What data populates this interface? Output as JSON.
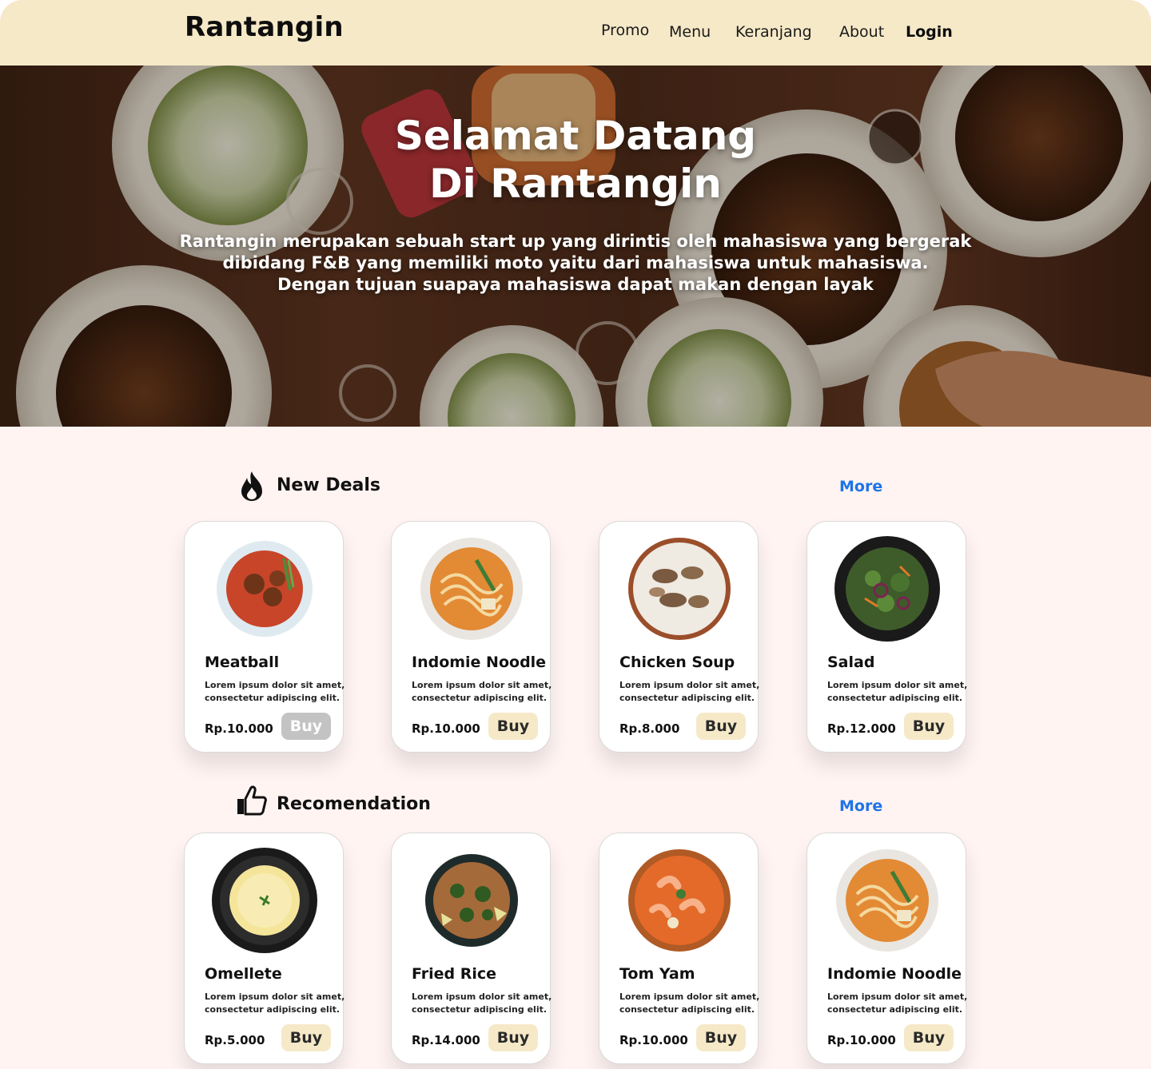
{
  "navbar": {
    "brand": "Rantangin",
    "links": {
      "promo": "Promo",
      "menu": "Menu",
      "keranjang": "Keranjang",
      "about": "About",
      "login": "Login"
    }
  },
  "hero": {
    "title_line1": "Selamat Datang",
    "title_line2": "Di Rantangin",
    "desc_line1": "Rantangin merupakan sebuah start up yang dirintis oleh mahasiswa yang bergerak",
    "desc_line2": "dibidang F&B yang memiliki moto yaitu dari mahasiswa untuk mahasiswa.",
    "desc_line3": "Dengan tujuan suapaya mahasiswa dapat makan dengan layak"
  },
  "new_deals": {
    "title": "New Deals",
    "more": "More",
    "icon": "flame-icon",
    "items": [
      {
        "name": "Meatball",
        "desc_line1": "Lorem ipsum dolor sit amet,",
        "desc_line2": "consectetur adipiscing elit.",
        "price": "Rp.10.000",
        "buy": "Buy",
        "buy_state": "disabled",
        "dish": "meatball-dish-image"
      },
      {
        "name": "Indomie Noodle",
        "desc_line1": "Lorem ipsum dolor sit amet,",
        "desc_line2": "consectetur adipiscing elit.",
        "price": "Rp.10.000",
        "buy": "Buy",
        "buy_state": "active",
        "dish": "noodle-dish-image"
      },
      {
        "name": "Chicken Soup",
        "desc_line1": "Lorem ipsum dolor sit amet,",
        "desc_line2": "consectetur adipiscing elit.",
        "price": "Rp.8.000",
        "buy": "Buy",
        "buy_state": "active",
        "dish": "chicken-soup-dish-image"
      },
      {
        "name": "Salad",
        "desc_line1": "Lorem ipsum dolor sit amet,",
        "desc_line2": "consectetur adipiscing elit.",
        "price": "Rp.12.000",
        "buy": "Buy",
        "buy_state": "active",
        "dish": "salad-dish-image"
      }
    ]
  },
  "recomendation": {
    "title": "Recomendation",
    "more": "More",
    "icon": "thumbs-up-icon",
    "items": [
      {
        "name": "Omellete",
        "desc_line1": "Lorem ipsum dolor sit amet,",
        "desc_line2": "consectetur adipiscing elit.",
        "price": "Rp.5.000",
        "buy": "Buy",
        "buy_state": "active",
        "dish": "omelette-dish-image"
      },
      {
        "name": "Fried Rice",
        "desc_line1": "Lorem ipsum dolor sit amet,",
        "desc_line2": "consectetur adipiscing elit.",
        "price": "Rp.14.000",
        "buy": "Buy",
        "buy_state": "active",
        "dish": "fried-rice-dish-image"
      },
      {
        "name": "Tom Yam",
        "desc_line1": "Lorem ipsum dolor sit amet,",
        "desc_line2": "consectetur adipiscing elit.",
        "price": "Rp.10.000",
        "buy": "Buy",
        "buy_state": "active",
        "dish": "tom-yam-dish-image"
      },
      {
        "name": "Indomie Noodle",
        "desc_line1": "Lorem ipsum dolor sit amet,",
        "desc_line2": "consectetur adipiscing elit.",
        "price": "Rp.10.000",
        "buy": "Buy",
        "buy_state": "active",
        "dish": "noodle-dish-image"
      }
    ]
  },
  "colors": {
    "navbar_bg": "#f6e9c8",
    "page_bg": "#fff4f2",
    "more_link": "#1e73e8",
    "buy_button": "#f6e9c8",
    "buy_disabled": "#c3c3c3"
  }
}
